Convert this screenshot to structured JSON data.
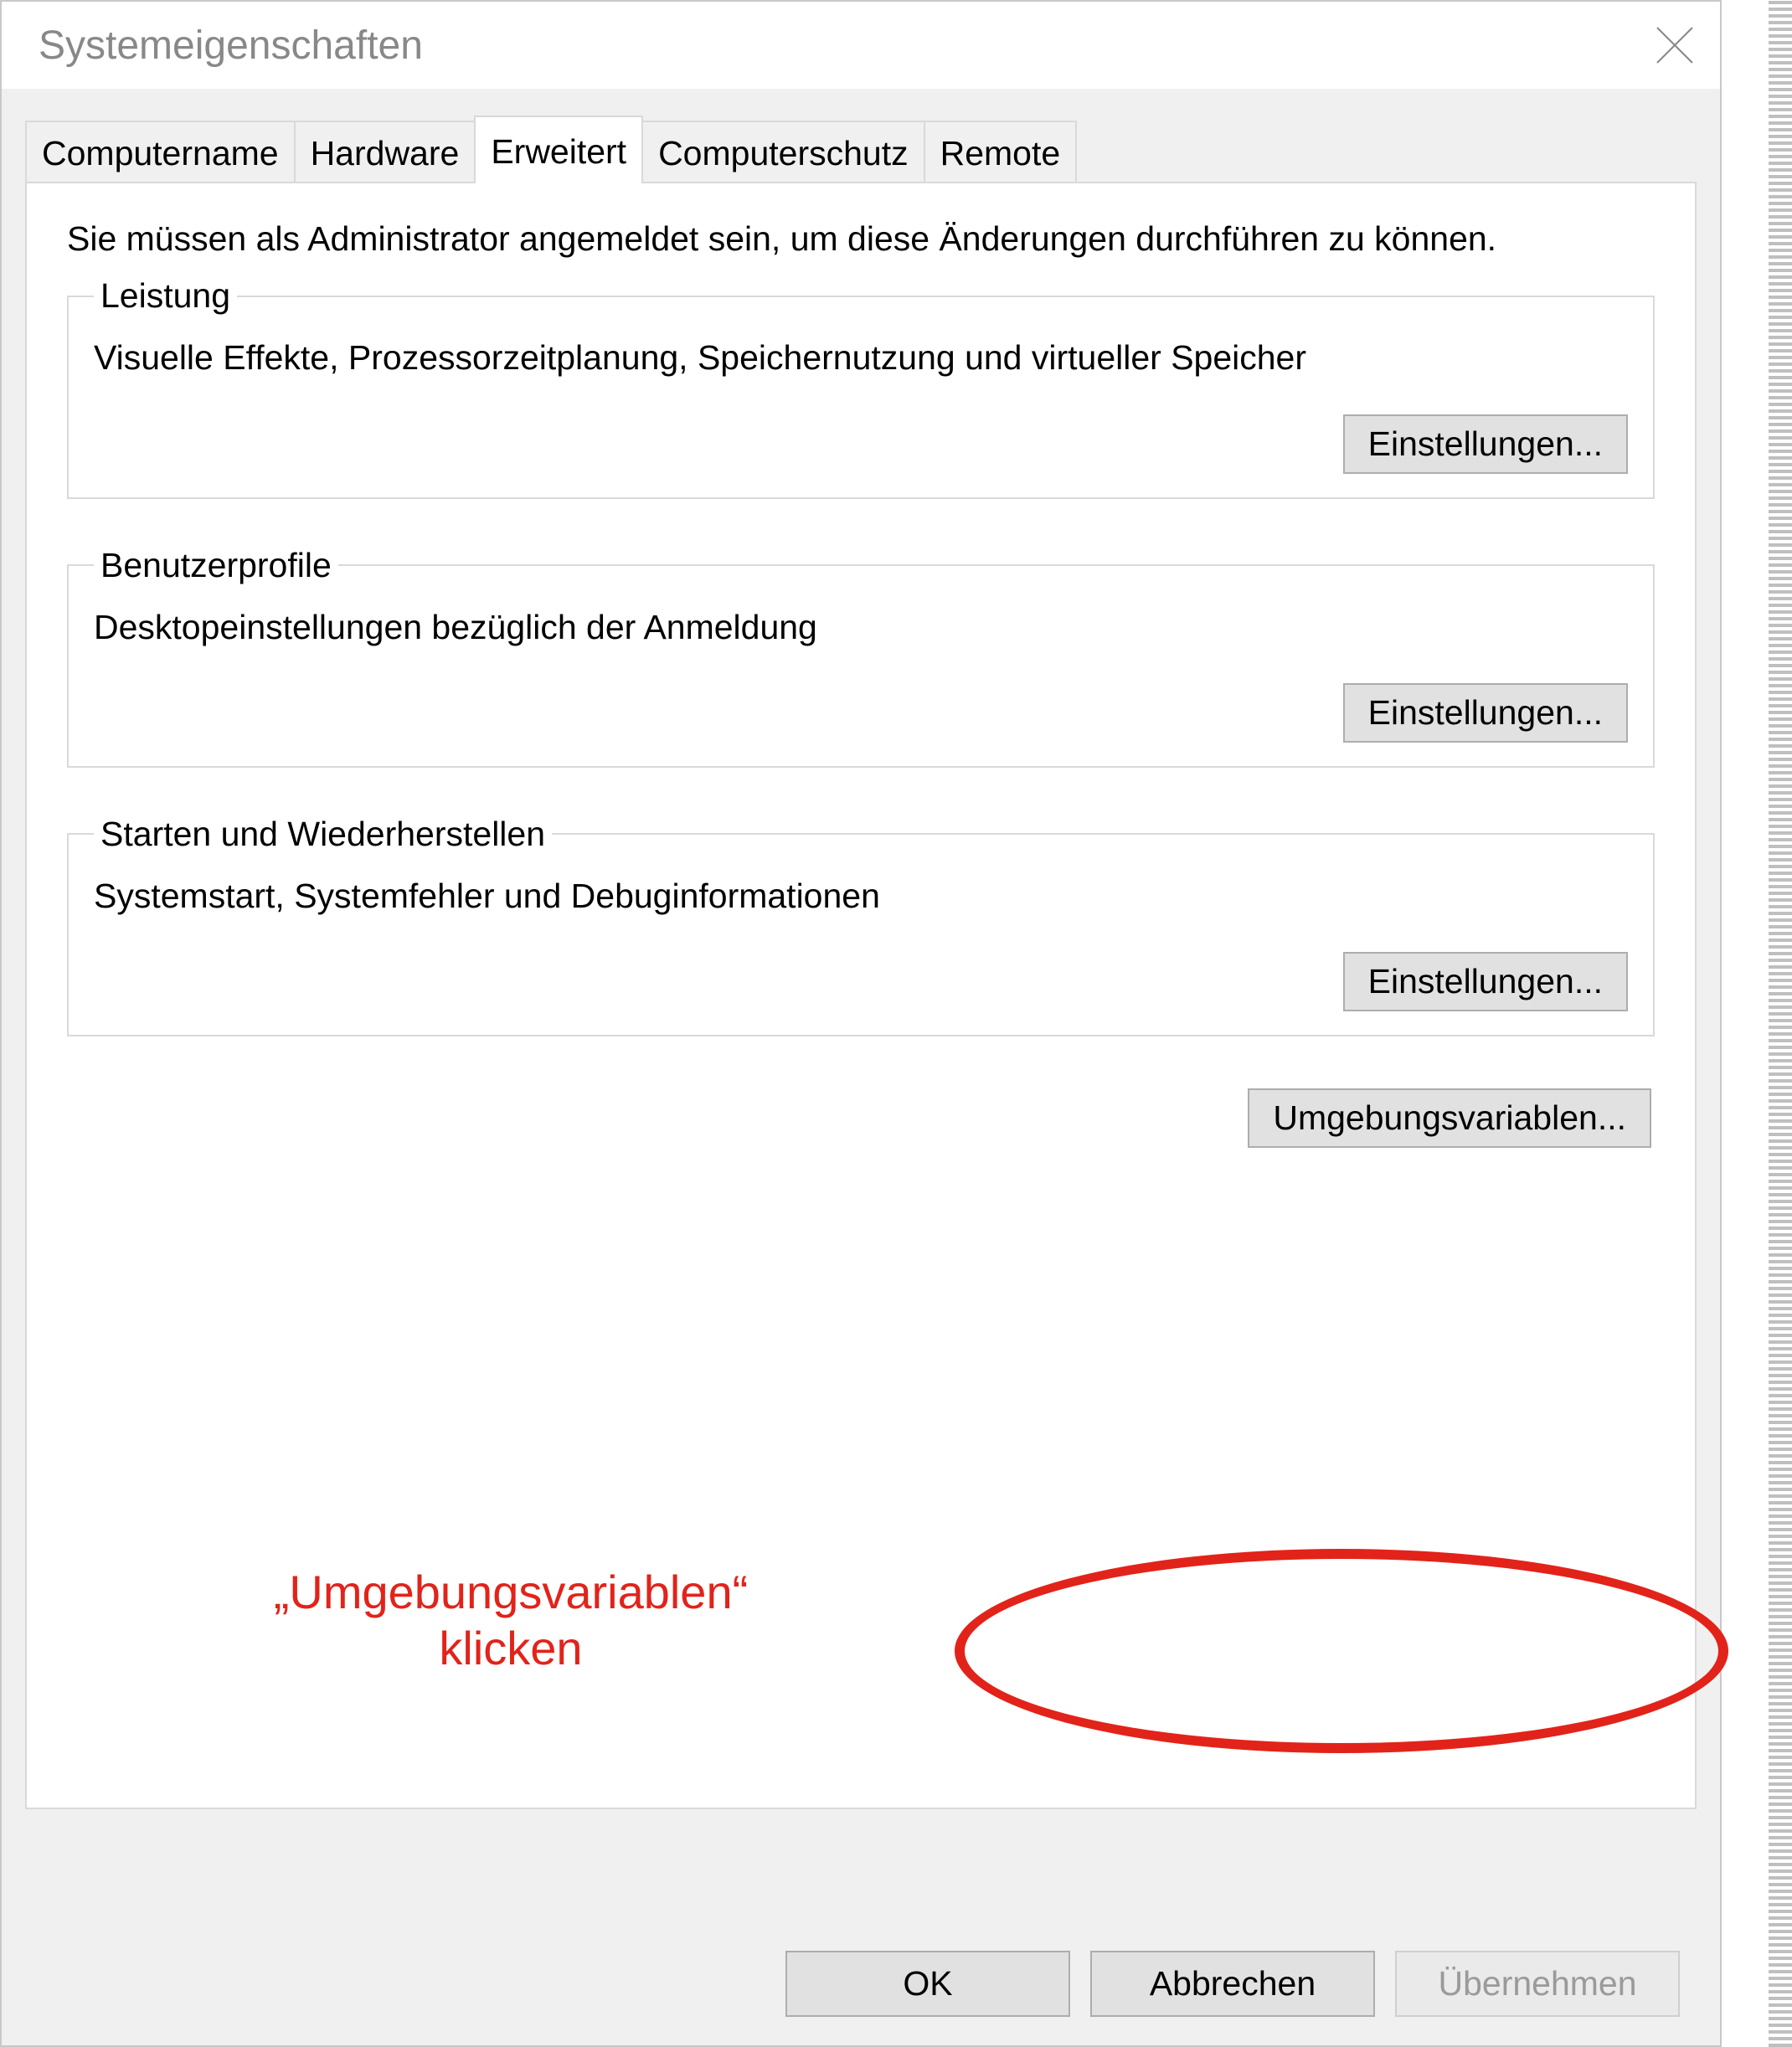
{
  "window": {
    "title": "Systemeigenschaften"
  },
  "tabs": {
    "t0": "Computername",
    "t1": "Hardware",
    "t2": "Erweitert",
    "t3": "Computerschutz",
    "t4": "Remote"
  },
  "panel": {
    "admin_note": "Sie müssen als Administrator angemeldet sein, um diese Änderungen durchführen zu können.",
    "settings_label": "Einstellungen...",
    "leistung": {
      "legend": "Leistung",
      "desc": "Visuelle Effekte, Prozessorzeitplanung, Speichernutzung und virtueller Speicher"
    },
    "benutzer": {
      "legend": "Benutzerprofile",
      "desc": "Desktopeinstellungen bezüglich der Anmeldung"
    },
    "starten": {
      "legend": "Starten und Wiederherstellen",
      "desc": "Systemstart, Systemfehler und Debuginformationen"
    },
    "envvar_label": "Umgebungsvariablen..."
  },
  "buttons": {
    "ok": "OK",
    "cancel": "Abbrechen",
    "apply": "Übernehmen"
  },
  "annotation": {
    "text": "„Umgebungsvariablen“\nklicken"
  }
}
